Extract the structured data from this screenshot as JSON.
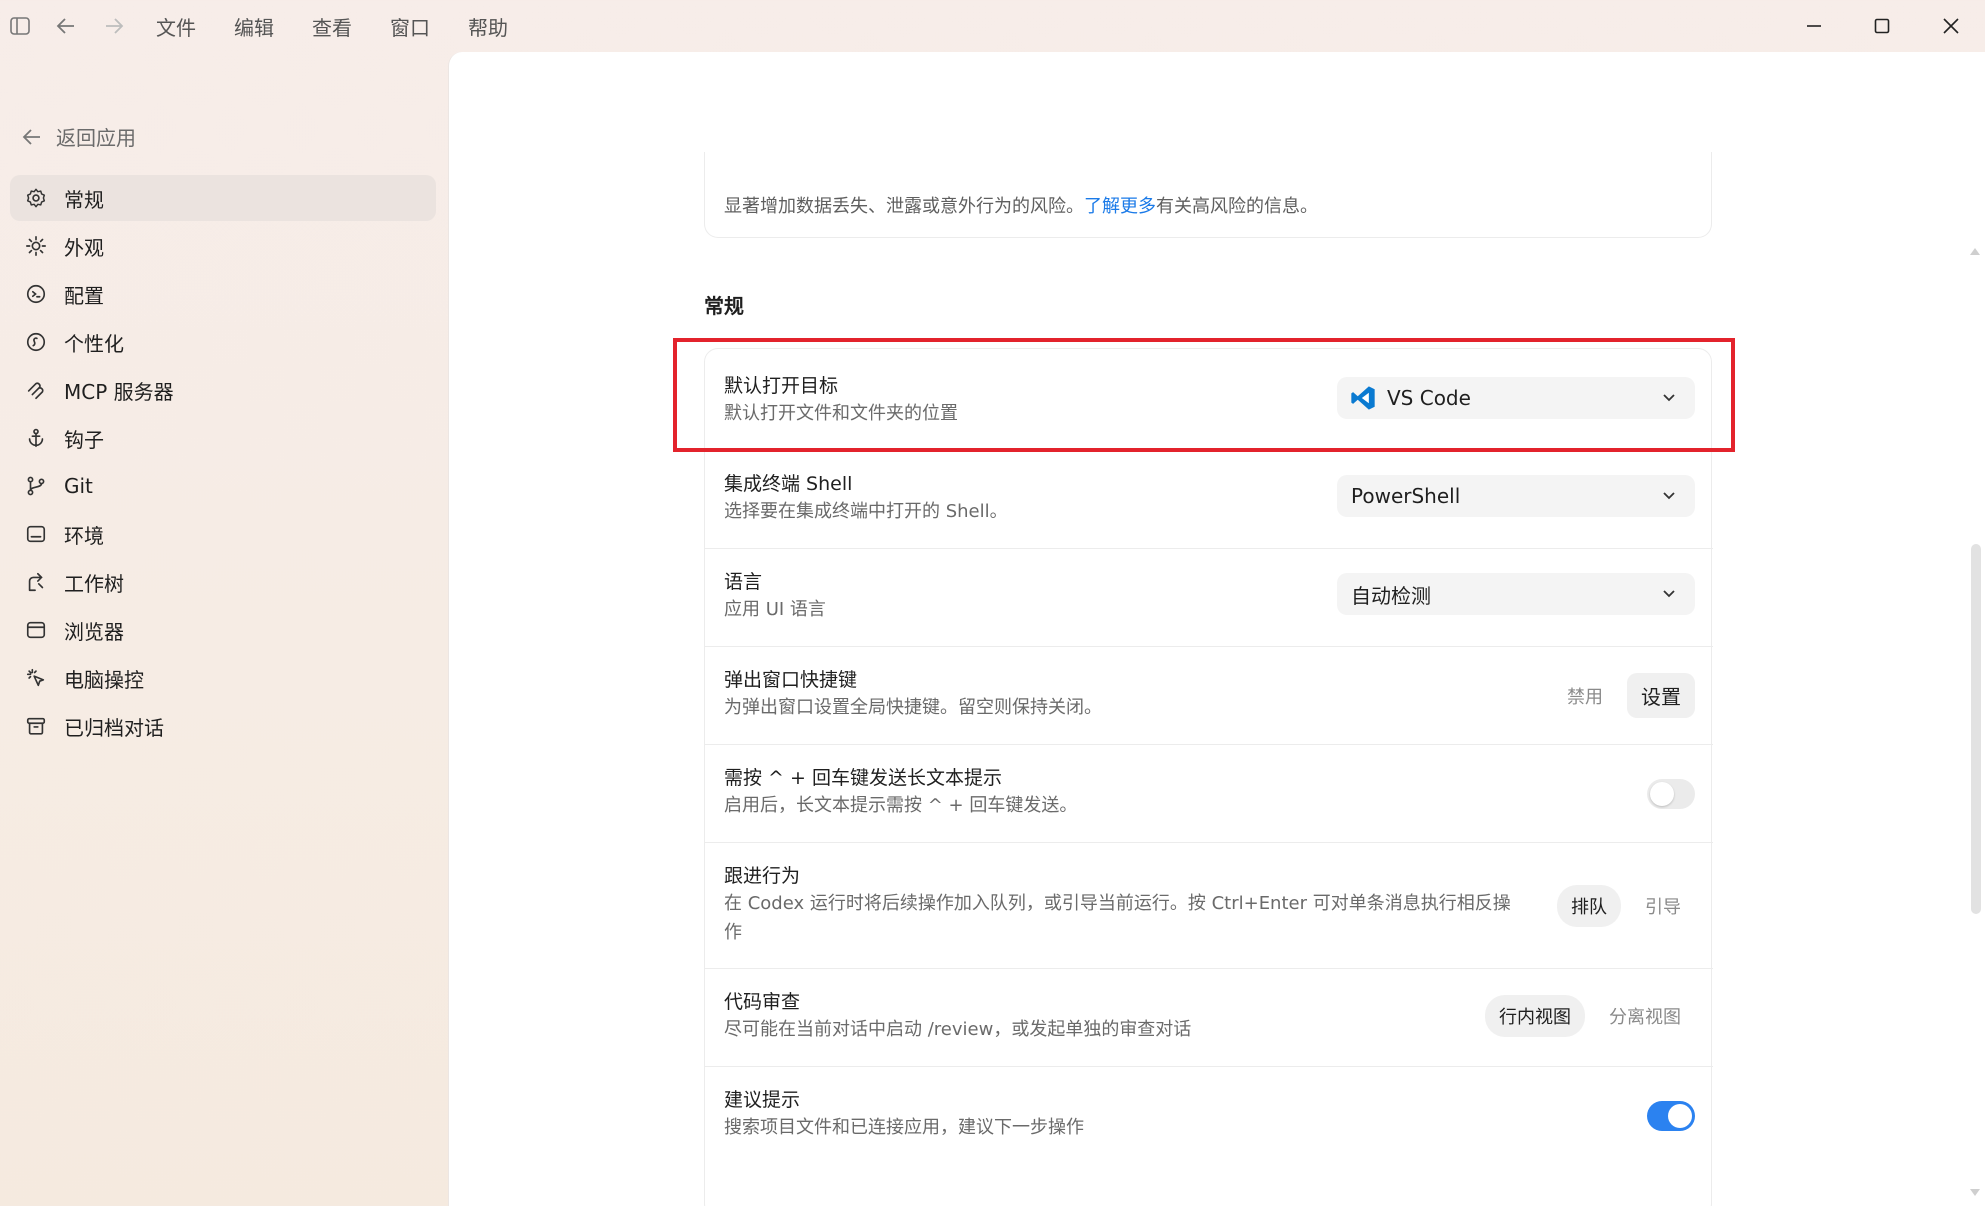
{
  "menu": [
    "文件",
    "编辑",
    "查看",
    "窗口",
    "帮助"
  ],
  "sidebar": {
    "back_label": "返回应用",
    "items": [
      {
        "label": "常规",
        "icon": "gear-icon",
        "active": true
      },
      {
        "label": "外观",
        "icon": "sun-icon",
        "active": false
      },
      {
        "label": "配置",
        "icon": "config-icon",
        "active": false
      },
      {
        "label": "个性化",
        "icon": "personalize-icon",
        "active": false
      },
      {
        "label": "MCP 服务器",
        "icon": "mcp-icon",
        "active": false
      },
      {
        "label": "钩子",
        "icon": "anchor-icon",
        "active": false
      },
      {
        "label": "Git",
        "icon": "git-branch-icon",
        "active": false
      },
      {
        "label": "环境",
        "icon": "environment-icon",
        "active": false
      },
      {
        "label": "工作树",
        "icon": "worktree-icon",
        "active": false
      },
      {
        "label": "浏览器",
        "icon": "browser-icon",
        "active": false
      },
      {
        "label": "电脑操控",
        "icon": "cursor-click-icon",
        "active": false
      },
      {
        "label": "已归档对话",
        "icon": "archive-icon",
        "active": false
      }
    ]
  },
  "main": {
    "top_note": {
      "before": "显著增加数据丢失、泄露或意外行为的风险。",
      "link": "了解更多",
      "after": "有关高风险的信息。"
    },
    "section_title": "常规",
    "settings": {
      "open_target": {
        "title": "默认打开目标",
        "desc": "默认打开文件和文件夹的位置",
        "value": "VS Code"
      },
      "shell": {
        "title": "集成终端 Shell",
        "desc": "选择要在集成终端中打开的 Shell。",
        "value": "PowerShell"
      },
      "language": {
        "title": "语言",
        "desc": "应用 UI 语言",
        "value": "自动检测"
      },
      "popup_shortcut": {
        "title": "弹出窗口快捷键",
        "desc": "为弹出窗口设置全局快捷键。留空则保持关闭。",
        "disabled_label": "禁用",
        "set_label": "设置"
      },
      "ctrl_enter": {
        "title": "需按 ^ + 回车键发送长文本提示",
        "desc": "启用后，长文本提示需按 ^ + 回车键发送。",
        "enabled": false
      },
      "follow_up": {
        "title": "跟进行为",
        "desc": "在 Codex 运行时将后续操作加入队列，或引导当前运行。按 Ctrl+Enter 可对单条消息执行相反操作",
        "options": [
          "排队",
          "引导"
        ],
        "selected": "排队"
      },
      "code_review": {
        "title": "代码审查",
        "desc": "尽可能在当前对话中启动 /review，或发起单独的审查对话",
        "options": [
          "行内视图",
          "分离视图"
        ],
        "selected": "行内视图"
      },
      "suggestions": {
        "title": "建议提示",
        "desc": "搜索项目文件和已连接应用，建议下一步操作",
        "enabled": true
      }
    }
  },
  "colors": {
    "accent": "#2b82f0",
    "link": "#1a7ae8",
    "highlight": "#e3232c",
    "vscode": "#0a7ad1"
  }
}
